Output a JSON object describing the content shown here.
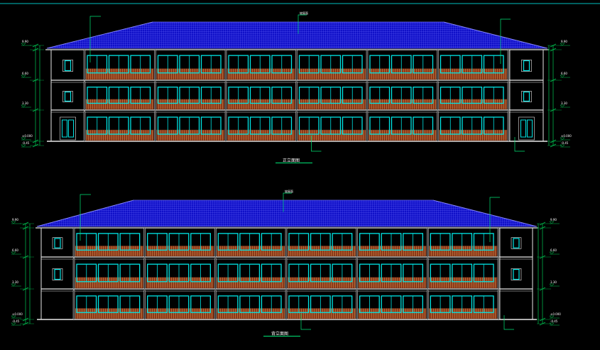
{
  "drawing": {
    "background": "#000000",
    "colors": {
      "roof": "#1010c8",
      "roof_grid": "#6b6bff",
      "wall_line": "#e8e8e8",
      "window": "#00e5e5",
      "balcony": "#8b3a1a",
      "railing": "#d48a4a",
      "dimension": "#00c853",
      "leader": "#00e676",
      "text": "#ffffff",
      "frame": "#00bfbf"
    },
    "elevations": [
      {
        "title": "正立面图",
        "levels": [
          "9.90",
          "6.60",
          "3.30",
          "±0.000",
          "-0.45"
        ],
        "roof_label": "坡屋面"
      },
      {
        "title": "背立面图",
        "levels": [
          "9.90",
          "6.60",
          "3.30",
          "±0.000",
          "-0.45"
        ],
        "roof_label": "坡屋面"
      }
    ]
  }
}
